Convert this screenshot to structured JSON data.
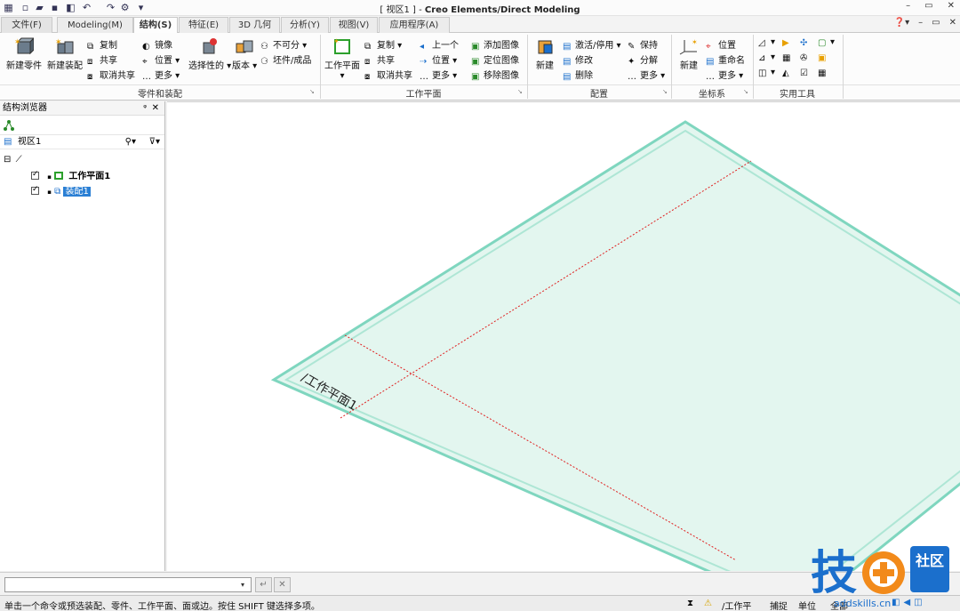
{
  "window": {
    "title": "[ 视区1 ] - Creo Elements/Direct Modeling",
    "controls": [
      "–",
      "▭",
      "✕"
    ],
    "inner_controls": [
      "–",
      "▭",
      "✕"
    ]
  },
  "tabs": [
    {
      "label": "文件(F)"
    },
    {
      "label": "Modeling(M)"
    },
    {
      "label": "结构(S)"
    },
    {
      "label": "特征(E)"
    },
    {
      "label": "3D 几何"
    },
    {
      "label": "分析(Y)"
    },
    {
      "label": "视图(V)"
    },
    {
      "label": "应用程序(A)"
    }
  ],
  "ribbon": {
    "parts": {
      "label": "零件和装配",
      "new_part": "新建零件",
      "new_assembly": "新建装配",
      "copy": "复制",
      "share": "共享",
      "unshare": "取消共享",
      "mirror": "镜像",
      "position": "位置",
      "more": "更多",
      "selective": "选择性的",
      "version": "版本",
      "indivisible": "不可分",
      "stock": "坯件/成品"
    },
    "workplane": {
      "label": "工作平面",
      "workplane": "工作平面",
      "copy": "复制",
      "share": "共享",
      "unshare": "取消共享",
      "prev": "上一个",
      "position": "位置",
      "more": "更多",
      "add_image": "添加图像",
      "locate_image": "定位图像",
      "remove_image": "移除图像"
    },
    "config": {
      "label": "配置",
      "new": "新建",
      "activate": "激活/停用",
      "modify": "修改",
      "delete": "删除",
      "keep": "保持",
      "decompose": "分解",
      "more": "更多"
    },
    "coord": {
      "label": "坐标系",
      "new": "新建",
      "position": "位置",
      "rename": "重命名",
      "more": "更多"
    },
    "tools": {
      "label": "实用工具"
    }
  },
  "browser": {
    "title": "结构浏览器",
    "view": "视区1",
    "items": [
      {
        "label": "工作平面1"
      },
      {
        "label": "装配1"
      }
    ]
  },
  "viewport": {
    "plane_label": "/工作平面1"
  },
  "cmdline": {
    "value": ""
  },
  "status": {
    "message": "单击一个命令或预选装配、零件、工作平面、面或边。按住 SHIFT 键选择多项。",
    "wp": "/工作平",
    "snap": "捕捉",
    "unit": "单位",
    "all": "全部"
  },
  "watermark": {
    "main": "技",
    "badge": "社区",
    "url": "addskills.cn"
  },
  "colors": {
    "plane_fill": "#e3f6ef",
    "plane_edge": "#7fd6bf",
    "axis": "#e02020",
    "accent": "#1b6fcc"
  }
}
